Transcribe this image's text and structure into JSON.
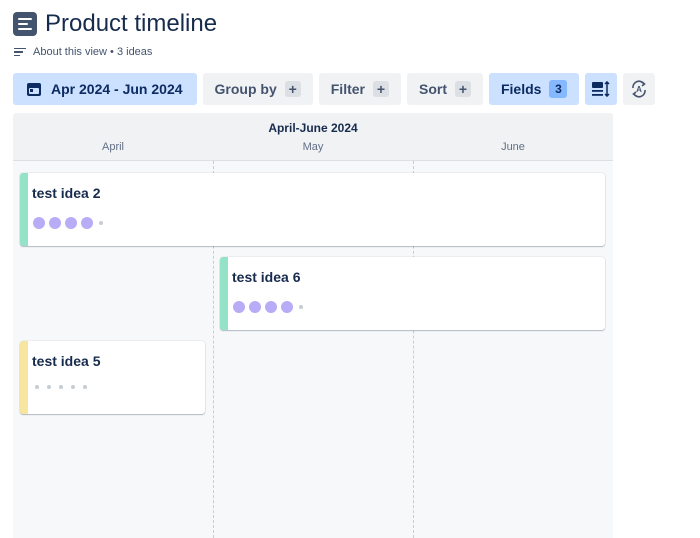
{
  "page": {
    "title": "Product timeline",
    "about": "About this view • 3 ideas"
  },
  "toolbar": {
    "date_range": "Apr 2024 - Jun 2024",
    "group_by": "Group by",
    "filter": "Filter",
    "sort": "Sort",
    "fields": "Fields",
    "fields_count": "3",
    "plus": "+"
  },
  "timeline": {
    "period": "April-June 2024",
    "months": [
      "April",
      "May",
      "June"
    ]
  },
  "ideas": [
    {
      "title": "test idea 2",
      "bar_color": "#94e3c6",
      "rating": 4,
      "max": 5
    },
    {
      "title": "test idea 6",
      "bar_color": "#94e3c6",
      "rating": 4,
      "max": 5
    },
    {
      "title": "test idea 5",
      "bar_color": "#f8e6a0",
      "rating": 0,
      "max": 5
    }
  ]
}
